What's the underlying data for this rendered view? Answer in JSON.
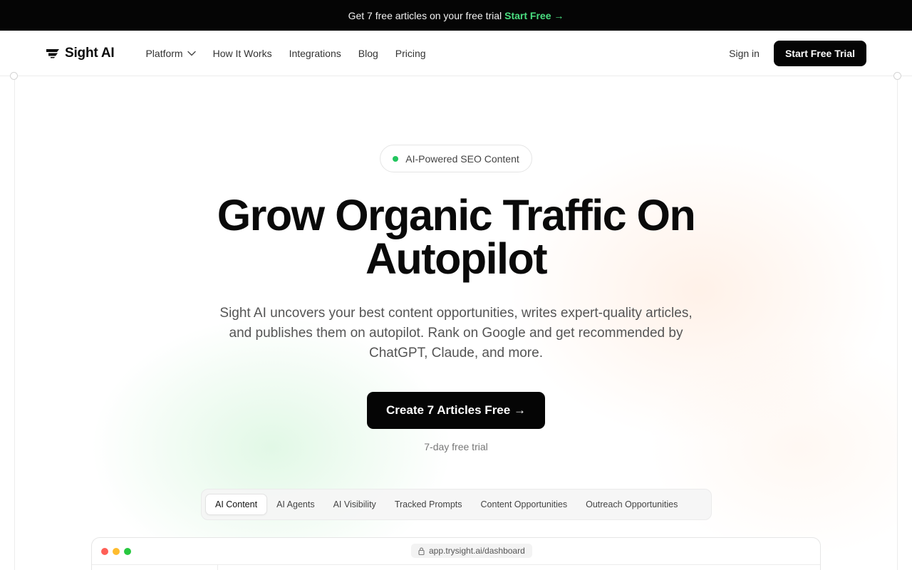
{
  "announcement": {
    "text": "Get 7 free articles on your free trial",
    "cta": "Start Free →"
  },
  "nav": {
    "brand": "Sight AI",
    "links": [
      {
        "label": "Platform",
        "has_dropdown": true
      },
      {
        "label": "How It Works"
      },
      {
        "label": "Integrations"
      },
      {
        "label": "Blog"
      },
      {
        "label": "Pricing"
      }
    ],
    "sign_in": "Sign in",
    "trial_button": "Start Free Trial"
  },
  "hero": {
    "badge": "AI-Powered SEO Content",
    "headline_line1": "Grow Organic Traffic On",
    "headline_line2": "Autopilot",
    "subtext": "Sight AI uncovers your best content opportunities, writes expert-quality articles, and publishes them on autopilot. Rank on Google and get recommended by ChatGPT, Claude, and more.",
    "cta": "Create 7 Articles Free →",
    "note": "7-day free trial"
  },
  "tabs": [
    {
      "label": "AI Content",
      "active": true
    },
    {
      "label": "AI Agents"
    },
    {
      "label": "AI Visibility"
    },
    {
      "label": "Tracked Prompts"
    },
    {
      "label": "Content Opportunities"
    },
    {
      "label": "Outreach Opportunities"
    }
  ],
  "browser": {
    "url": "app.trysight.ai/dashboard"
  },
  "colors": {
    "accent_green": "#4ade80",
    "badge_dot": "#22c55e",
    "dark": "#050505",
    "traffic_red": "#ff5f57",
    "traffic_yellow": "#febc2e",
    "traffic_green": "#28c840"
  }
}
